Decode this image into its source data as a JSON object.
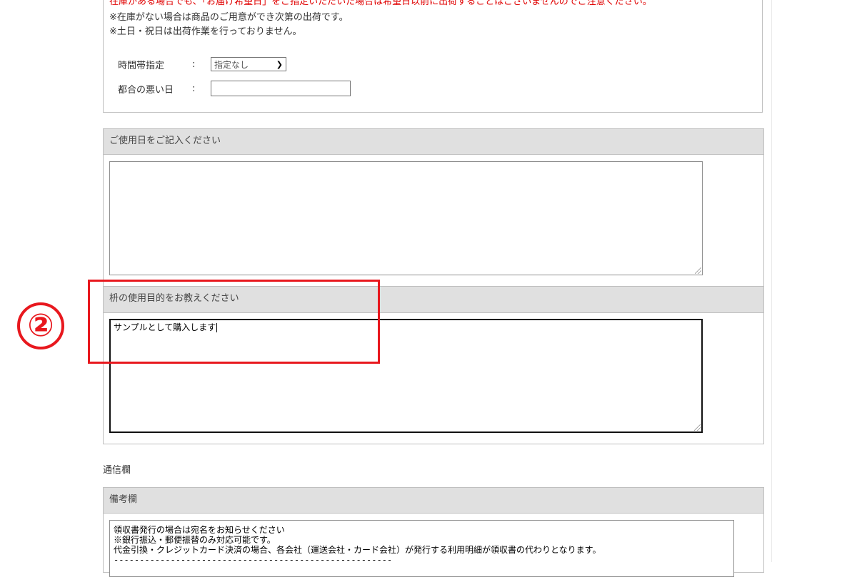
{
  "delivery": {
    "notice_red": "在庫がある場合でも、「お届け希望日」をご指定いただいた場合は希望日以前に出荷することはございませんのでご注意ください。",
    "notice_1": "※在庫がない場合は商品のご用意ができ次第の出荷です。",
    "notice_2": "※土日・祝日は出荷作業を行っておりません。",
    "time_label": "時間帯指定",
    "colon": ":",
    "time_select_value": "指定なし",
    "bad_day_label": "都合の悪い日",
    "bad_day_value": ""
  },
  "usage_date": {
    "header": "ご使用日をご記入ください",
    "value": ""
  },
  "purpose": {
    "header": "枡の使用目的をお教えください",
    "value": "サンプルとして購入します"
  },
  "communication": {
    "section_label": "通信欄",
    "remarks_header": "備考欄",
    "remarks_lines": [
      "領収書発行の場合は宛名をお知らせください",
      "※銀行振込・郵便振替のみ対応可能です。",
      "代金引換・クレジットカード決済の場合、各会社（運送会社・カード会社）が発行する利用明細が領収書の代わりとなります。",
      "------------------------------------------------------"
    ]
  },
  "annotation": {
    "number": "②",
    "color": "#e8181e"
  }
}
